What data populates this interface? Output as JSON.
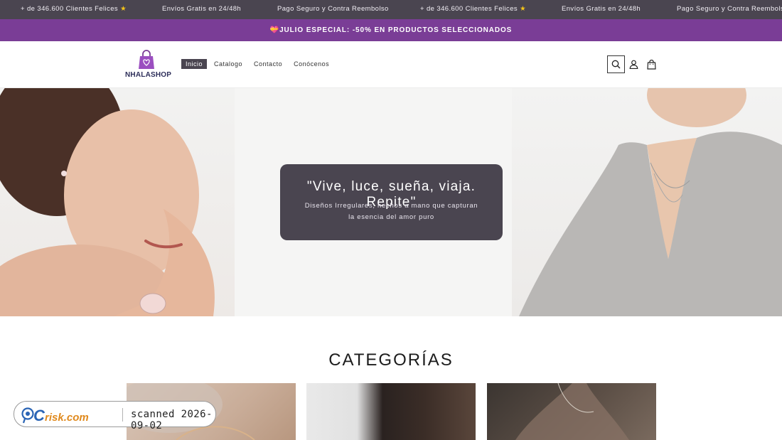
{
  "marquee": {
    "items": [
      {
        "text": "+ de 346.600 Clientes Felices",
        "icon": "star-icon"
      },
      {
        "text": "Envíos Gratis en 24/48h"
      },
      {
        "text": "Pago Seguro y Contra Reembolso"
      },
      {
        "text": "+ de 346.600 Clientes Felices",
        "icon": "star-icon"
      },
      {
        "text": "Envíos Gratis en 24/48h"
      },
      {
        "text": "Pago Seguro y Contra Reembolso"
      }
    ],
    "background": "#4a4550"
  },
  "promo": {
    "text": "💝JULIO ESPECIAL: -50% EN PRODUCTOS SELECCIONADOS",
    "background": "#7a3d96"
  },
  "header": {
    "logo_text": "NHALASHOP",
    "nav": [
      {
        "label": "Inicio",
        "active": true
      },
      {
        "label": "Catalogo",
        "active": false
      },
      {
        "label": "Contacto",
        "active": false
      },
      {
        "label": "Conócenos",
        "active": false
      }
    ],
    "icons": [
      "search-icon",
      "account-icon",
      "cart-icon"
    ]
  },
  "hero": {
    "title": "\"Vive, luce, sueña, viaja. Repite\"",
    "subtitle": "Diseños Irregulares, hechos a mano que capturan la esencia del amor puro",
    "card_color": "#4a4550"
  },
  "categories": {
    "title": "CATEGORÍAS",
    "items": [
      "category-bracelets",
      "category-earrings",
      "category-necklaces"
    ]
  },
  "watermark": {
    "logo_text": "PCrisk.com",
    "scan_text": "scanned 2026-09-02"
  }
}
